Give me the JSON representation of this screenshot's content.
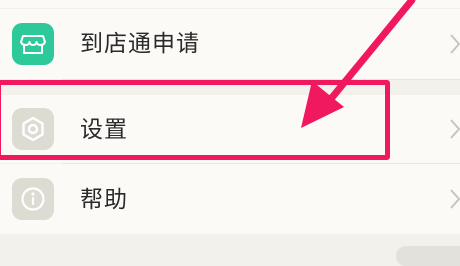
{
  "menu": {
    "items": [
      {
        "label": "到店通申请",
        "icon": "store-icon",
        "icon_color": "#2ec99b"
      },
      {
        "label": "设置",
        "icon": "settings-hexagon-icon",
        "icon_color": "#dddcd2"
      },
      {
        "label": "帮助",
        "icon": "info-icon",
        "icon_color": "#dddcd2"
      }
    ]
  },
  "annotation": {
    "color": "#f0185e",
    "target": "设置"
  }
}
